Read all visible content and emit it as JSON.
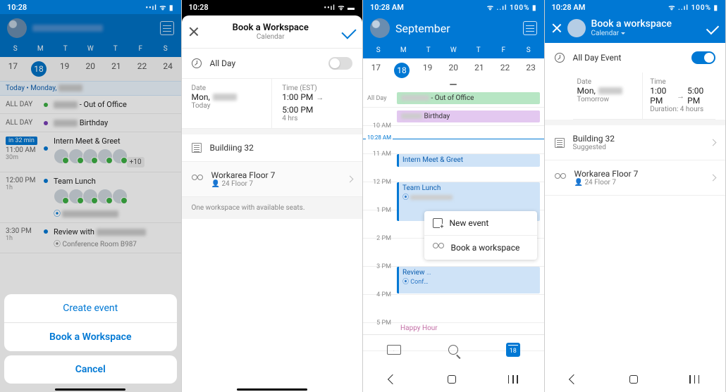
{
  "s1": {
    "time": "10:28",
    "signal": "••ıl ᯤ ▮",
    "weekdays": [
      "S",
      "M",
      "T",
      "W",
      "T",
      "F",
      "S"
    ],
    "dates": [
      "17",
      "18",
      "19",
      "20",
      "21",
      "22",
      "24"
    ],
    "selectedIndex": 1,
    "todayPrefix": "Today • Monday,",
    "allday_label": "ALL DAY",
    "ev_allday1_suffix": " - Out of Office",
    "ev_allday1_color": "#3cb043",
    "ev_allday2_suffix": " Birthday",
    "ev_allday2_color": "#7a3fb5",
    "soon_chip": "in 32 min",
    "ev1_time": "11:00 AM",
    "ev1_dur": "30m",
    "ev1_title": "Intern Meet & Greet",
    "ev1_more": "+10",
    "ev2_time": "12:00 PM",
    "ev2_dur": "1h",
    "ev2_title": "Team Lunch",
    "ev3_time": "3:30 PM",
    "ev3_dur": "1h",
    "ev3_title_prefix": "Review with ",
    "ev3_loc_prefix": "Conference Room B987",
    "sheet_create": "Create event",
    "sheet_book": "Book a Workspace",
    "sheet_cancel": "Cancel"
  },
  "s2": {
    "time": "10:28",
    "signal": "••ıl ᯤ ▬",
    "title": "Book a Workspace",
    "subtitle": "Calendar",
    "allday": "All Day",
    "date_lbl": "Date",
    "date_val_prefix": "Mon,",
    "date_sub": "Today",
    "time_lbl": "Time (EST)",
    "time_from": "1:00 PM",
    "time_to": "5:00 PM",
    "time_sub": "4 hrs",
    "building": "Buildiing 32",
    "workarea_title": "Workarea Floor 7",
    "workarea_sub": "24   Floor 7",
    "hint": "One workspace with available seats."
  },
  "s3": {
    "time": "10:28 AM",
    "battery": "100%",
    "signal": "ᯤ ..ıl",
    "month": "September",
    "weekdays": [
      "S",
      "M",
      "T",
      "W",
      "T",
      "F",
      "S"
    ],
    "dates": [
      "17",
      "18",
      "19",
      "20",
      "21",
      "22",
      "23"
    ],
    "allday_label": "All Day",
    "allday1_suffix": " - Out of Office",
    "allday2_suffix": " Birthday",
    "hours": [
      "10 AM",
      "11 AM",
      "12 PM",
      "1 PM",
      "2 PM",
      "3 PM",
      "4 PM",
      "5 PM"
    ],
    "now": "10:28 AM",
    "ev1": "Intern Meet & Greet",
    "ev2": "Team Lunch",
    "ev3_prefix": "Review",
    "ev4": "Happy Hour",
    "popup_new": "New event",
    "popup_book": "Book a workspace",
    "cal_day": "18"
  },
  "s4": {
    "time": "10:28 AM",
    "battery": "100%",
    "signal": "ᯤ ..ıl",
    "title": "Book a workspace",
    "subtitle": "Calendar",
    "allday": "All Day Event",
    "date_lbl": "Date",
    "date_val_prefix": "Mon,",
    "date_sub": "Tomorrow",
    "time_lbl": "Time",
    "time_from": "1:00 PM",
    "time_to": "5:00 PM",
    "time_sub": "Duration: 4 hours",
    "building": "Building 32",
    "building_sub": "Suggested",
    "workarea": "Workarea Floor 7",
    "workarea_sub": "24   Floor 7"
  }
}
